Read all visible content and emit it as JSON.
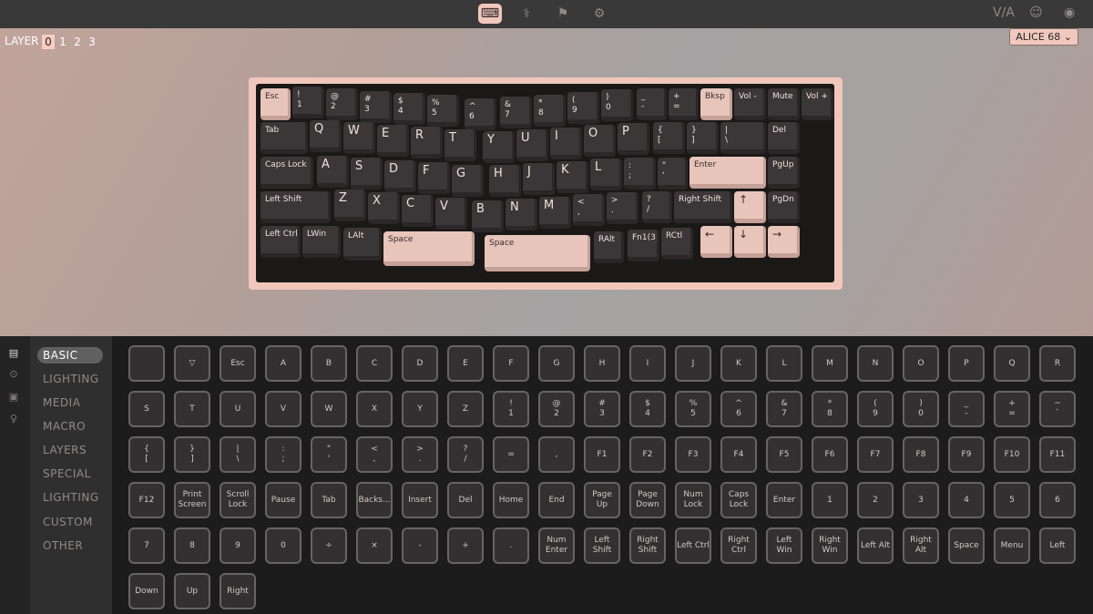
{
  "toolbar": {
    "icons": [
      "keyboard-icon",
      "stethoscope-icon",
      "flag-icon",
      "gear-icon"
    ],
    "right_icons": [
      "via-logo",
      "discord-icon",
      "github-icon"
    ],
    "via_text": "V/A"
  },
  "layer": {
    "label": "LAYER",
    "options": [
      "0",
      "1",
      "2",
      "3"
    ],
    "selected": "0"
  },
  "keyboard_select": {
    "value": "ALICE 68 ⌄"
  },
  "keyboard": {
    "keys": [
      "Esc",
      "!\n1",
      "@\n2",
      "#\n3",
      "$\n4",
      "%\n5",
      "^\n6",
      "&\n7",
      "*\n8",
      "(\n9",
      ")\n0",
      "_\n-",
      "+\n=",
      "Bksp",
      "Vol -",
      "Mute",
      "Vol +",
      "Tab",
      "Q",
      "W",
      "E",
      "R",
      "T",
      "Y",
      "U",
      "I",
      "O",
      "P",
      "{\n[",
      "}\n]",
      "|\n\\",
      "Del",
      "Caps Lock",
      "A",
      "S",
      "D",
      "F",
      "G",
      "H",
      "J",
      "K",
      "L",
      ":\n;",
      "\"\n'",
      "Enter",
      "PgUp",
      "Left Shift",
      "Z",
      "X",
      "C",
      "V",
      "B",
      "N",
      "M",
      "<\n,",
      ">\n.",
      "?\n/",
      "Right Shift",
      "↑",
      "PgDn",
      "Left Ctrl",
      "LWin",
      "LAlt",
      "Space",
      "Space",
      "RAlt",
      "Fn1(3)",
      "RCtl",
      "←",
      "↓",
      "→"
    ]
  },
  "sidebar": {
    "icons": [
      "keyboard-icon",
      "cog-icon",
      "save-icon",
      "bulb-icon"
    ]
  },
  "menu": {
    "items": [
      "BASIC",
      "LIGHTING",
      "MEDIA",
      "MACRO",
      "LAYERS",
      "SPECIAL",
      "LIGHTING",
      "CUSTOM",
      "OTHER"
    ],
    "selected": "BASIC"
  },
  "keycodes": [
    "",
    "▽",
    "Esc",
    "A",
    "B",
    "C",
    "D",
    "E",
    "F",
    "G",
    "H",
    "I",
    "J",
    "K",
    "L",
    "M",
    "N",
    "O",
    "P",
    "Q",
    "R",
    "S",
    "T",
    "U",
    "V",
    "W",
    "X",
    "Y",
    "Z",
    "!\n1",
    "@\n2",
    "#\n3",
    "$\n4",
    "%\n5",
    "^\n6",
    "&\n7",
    "*\n8",
    "(\n9",
    ")\n0",
    "_\n-",
    "+\n=",
    "~\n`",
    "{\n[",
    "}\n]",
    "|\n\\",
    ":\n;",
    "\"\n'",
    "<\n,",
    ">\n.",
    "?\n/",
    "=",
    ",",
    "F1",
    "F2",
    "F3",
    "F4",
    "F5",
    "F6",
    "F7",
    "F8",
    "F9",
    "F10",
    "F11",
    "F12",
    "Print\nScreen",
    "Scroll\nLock",
    "Pause",
    "Tab",
    "Backs...",
    "Insert",
    "Del",
    "Home",
    "End",
    "Page\nUp",
    "Page\nDown",
    "Num\nLock",
    "Caps\nLock",
    "Enter",
    "1",
    "2",
    "3",
    "4",
    "5",
    "6",
    "7",
    "8",
    "9",
    "0",
    "÷",
    "×",
    "-",
    "+",
    ".",
    "Num\nEnter",
    "Left\nShift",
    "Right\nShift",
    "Left Ctrl",
    "Right\nCtrl",
    "Left\nWin",
    "Right\nWin",
    "Left Alt",
    "Right\nAlt",
    "Space",
    "Menu",
    "Left",
    "Down",
    "Up",
    "Right"
  ]
}
